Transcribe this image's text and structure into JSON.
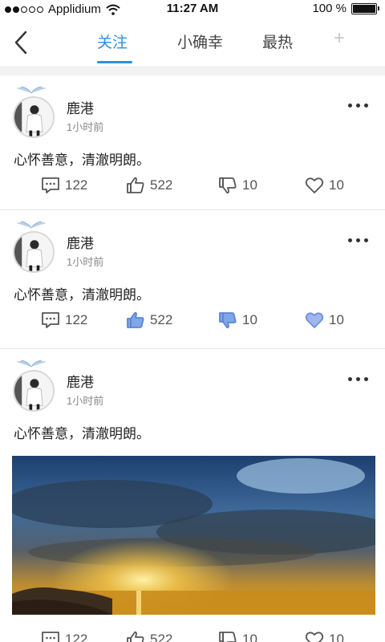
{
  "status_bar": {
    "carrier": "Applidium",
    "time": "11:27 AM",
    "battery": "100 %",
    "signal_dots_filled": 2,
    "signal_dots_total": 5
  },
  "nav": {
    "tabs": [
      {
        "label": "关注",
        "active": true
      },
      {
        "label": "小确幸",
        "active": false
      },
      {
        "label": "最热",
        "active": false
      }
    ],
    "plus_label": "+",
    "accent": "#2f8ee0"
  },
  "posts": [
    {
      "username": "鹿港",
      "time": "1小时前",
      "text": "心怀善意，清澈明朗。",
      "comments": "122",
      "likes": "522",
      "dislikes": "10",
      "favorites": "10",
      "state": "outline"
    },
    {
      "username": "鹿港",
      "time": "1小时前",
      "text": "心怀善意，清澈明朗。",
      "comments": "122",
      "likes": "522",
      "dislikes": "10",
      "favorites": "10",
      "state": "filled"
    },
    {
      "username": "鹿港",
      "time": "1小时前",
      "text": "心怀善意，清澈明朗。",
      "comments": "122",
      "likes": "522",
      "dislikes": "10",
      "favorites": "10",
      "state": "outline",
      "has_image": true
    }
  ]
}
